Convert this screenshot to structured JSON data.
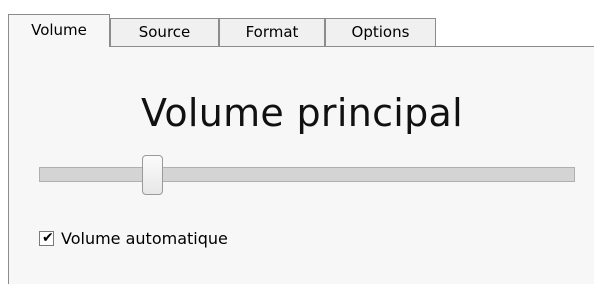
{
  "tabs": [
    {
      "label": "Volume",
      "active": true
    },
    {
      "label": "Source",
      "active": false
    },
    {
      "label": "Format",
      "active": false
    },
    {
      "label": "Options",
      "active": false
    }
  ],
  "panel": {
    "title": "Volume principal",
    "slider": {
      "value_fraction": 0.2
    },
    "checkbox": {
      "label": "Volume automatique",
      "checked": true,
      "check_glyph": "✔"
    }
  }
}
